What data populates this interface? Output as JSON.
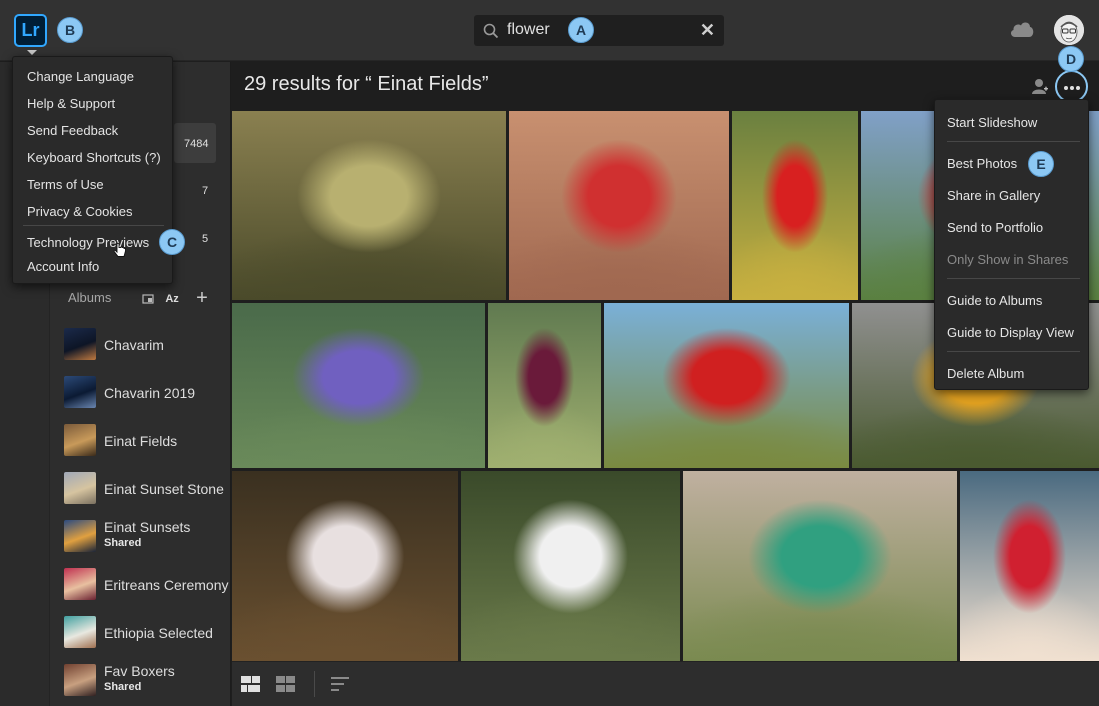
{
  "app": {
    "logo_text": "Lr"
  },
  "search": {
    "value": "flower",
    "clear_icon": "✕"
  },
  "header": {
    "results_title": "29 results for “ Einat Fields”"
  },
  "badges": {
    "a": "A",
    "b": "B",
    "c": "C",
    "d": "D",
    "e": "E"
  },
  "app_menu": {
    "items": [
      "Change Language",
      "Help & Support",
      "Send Feedback",
      "Keyboard Shortcuts (?)",
      "Terms of Use",
      "Privacy & Cookies",
      "Technology Previews",
      "Account Info"
    ]
  },
  "sidebar": {
    "counts": [
      "7484",
      "7",
      "5"
    ],
    "albums_label": "Albums",
    "sort_label": "Az",
    "add_label": "+",
    "albums": [
      {
        "name": "Chavarim",
        "sub": "",
        "colors": [
          "#1b2a4a",
          "#0d1526",
          "#c07a40"
        ]
      },
      {
        "name": "Chavarin 2019",
        "sub": "",
        "colors": [
          "#2c4a78",
          "#0b1a33",
          "#6a86b0"
        ]
      },
      {
        "name": "Einat Fields",
        "sub": "",
        "colors": [
          "#7a5a3a",
          "#c89a5a",
          "#3a2a1a"
        ]
      },
      {
        "name": "Einat Sunset Stone",
        "sub": "",
        "colors": [
          "#a0a8b8",
          "#d6c4a0",
          "#7a7060"
        ]
      },
      {
        "name": "Einat Sunsets",
        "sub": "Shared",
        "colors": [
          "#2a4a80",
          "#e0a040",
          "#1a2438"
        ]
      },
      {
        "name": "Eritreans Ceremony",
        "sub": "",
        "colors": [
          "#c03050",
          "#e8c0a0",
          "#6a2030"
        ]
      },
      {
        "name": "Ethiopia Selected",
        "sub": "",
        "colors": [
          "#40a0a0",
          "#e8e8e0",
          "#a07050"
        ]
      },
      {
        "name": "Fav Boxers",
        "sub": "Shared",
        "colors": [
          "#704030",
          "#c8a080",
          "#302020"
        ]
      }
    ]
  },
  "more_menu": {
    "items": [
      {
        "label": "Start Slideshow",
        "enabled": true
      },
      {
        "label": "Best Photos",
        "enabled": true
      },
      {
        "label": "Share in Gallery",
        "enabled": true
      },
      {
        "label": "Send to Portfolio",
        "enabled": true
      },
      {
        "label": "Only Show in Shares",
        "enabled": false
      },
      {
        "label": "Guide to Albums",
        "enabled": true
      },
      {
        "label": "Guide to Display View",
        "enabled": true
      },
      {
        "label": "Delete Album",
        "enabled": true
      }
    ]
  },
  "photos": [
    {
      "subject": "dried-umbel",
      "colors": [
        "#8a8050",
        "#b8b070",
        "#4a4a2a"
      ]
    },
    {
      "subject": "red-flower-branch",
      "colors": [
        "#c89070",
        "#d03030",
        "#a06850"
      ]
    },
    {
      "subject": "red-anemone",
      "colors": [
        "#6a8040",
        "#d82020",
        "#c8b040"
      ]
    },
    {
      "subject": "red-anemone-sky",
      "colors": [
        "#80a0c8",
        "#d82020",
        "#5a8040"
      ]
    },
    {
      "subject": "purple-thistle",
      "colors": [
        "#4a6a4a",
        "#7060c0",
        "#6a8a5a"
      ]
    },
    {
      "subject": "purple-iris",
      "colors": [
        "#607a50",
        "#6a1a3a",
        "#a0b070"
      ]
    },
    {
      "subject": "red-anemones-field",
      "colors": [
        "#7ab0d8",
        "#d02020",
        "#7a8a40"
      ]
    },
    {
      "subject": "sunflowers",
      "colors": [
        "#909090",
        "#e0a020",
        "#4a5a30"
      ]
    },
    {
      "subject": "white-blossoms-bee",
      "colors": [
        "#3a3020",
        "#e8e0e0",
        "#6a5030"
      ]
    },
    {
      "subject": "white-peacock",
      "colors": [
        "#3a4a2a",
        "#f0f0f0",
        "#6a7a4a"
      ]
    },
    {
      "subject": "beetle-on-thistle",
      "colors": [
        "#c0b0a0",
        "#30a080",
        "#7a8a50"
      ]
    },
    {
      "subject": "woman-flower-crown",
      "colors": [
        "#4a6a80",
        "#d02030",
        "#f0e0d0"
      ]
    }
  ],
  "icons": {
    "search": "search-icon",
    "cloud": "cloud-icon",
    "more": "more-horizontal-icon",
    "person": "person-add-icon"
  }
}
